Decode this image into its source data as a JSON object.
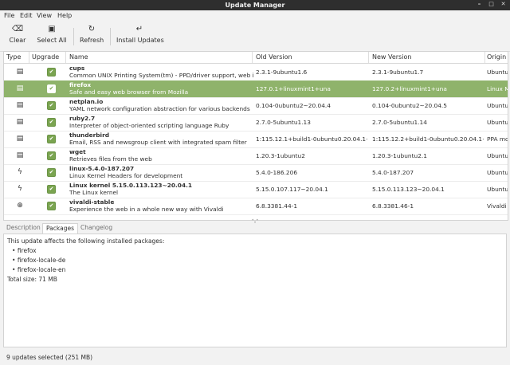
{
  "window": {
    "title": "Update Manager"
  },
  "menu": [
    "File",
    "Edit",
    "View",
    "Help"
  ],
  "toolbar": {
    "clear": "Clear",
    "select_all": "Select All",
    "refresh": "Refresh",
    "install": "Install Updates"
  },
  "columns": {
    "type": "Type",
    "upgrade": "Upgrade",
    "name": "Name",
    "old": "Old Version",
    "new": "New Version",
    "origin": "Origin"
  },
  "updates": [
    {
      "type_icon": "package-icon",
      "name": "cups",
      "desc": "Common UNIX Printing System(tm) - PPD/driver support, web interface",
      "old": "2.3.1-9ubuntu1.6",
      "new": "2.3.1-9ubuntu1.7",
      "origin": "Ubuntu",
      "checked": true,
      "selected": false
    },
    {
      "type_icon": "package-icon",
      "name": "firefox",
      "desc": "Safe and easy web browser from Mozilla",
      "old": "127.0.1+linuxmint1+una",
      "new": "127.0.2+linuxmint1+una",
      "origin": "Linux M",
      "checked": true,
      "selected": true
    },
    {
      "type_icon": "package-icon",
      "name": "netplan.io",
      "desc": "YAML network configuration abstraction for various backends",
      "old": "0.104-0ubuntu2~20.04.4",
      "new": "0.104-0ubuntu2~20.04.5",
      "origin": "Ubuntu",
      "checked": true,
      "selected": false
    },
    {
      "type_icon": "package-icon",
      "name": "ruby2.7",
      "desc": "Interpreter of object-oriented scripting language Ruby",
      "old": "2.7.0-5ubuntu1.13",
      "new": "2.7.0-5ubuntu1.14",
      "origin": "Ubuntu",
      "checked": true,
      "selected": false
    },
    {
      "type_icon": "package-icon",
      "name": "thunderbird",
      "desc": "Email, RSS and newsgroup client with integrated spam filter",
      "old": "1:115.12.1+build1-0ubuntu0.20.04.1~mt1",
      "new": "1:115.12.2+build1-0ubuntu0.20.04.1~mt1",
      "origin": "PPA moz",
      "checked": true,
      "selected": false
    },
    {
      "type_icon": "package-icon",
      "name": "wget",
      "desc": "Retrieves files from the web",
      "old": "1.20.3-1ubuntu2",
      "new": "1.20.3-1ubuntu2.1",
      "origin": "Ubuntu",
      "checked": true,
      "selected": false
    },
    {
      "type_icon": "kernel-icon",
      "name": "linux-5.4.0-187.207",
      "desc": "Linux Kernel Headers for development",
      "old": "5.4.0-186.206",
      "new": "5.4.0-187.207",
      "origin": "Ubuntu",
      "checked": true,
      "selected": false
    },
    {
      "type_icon": "kernel-icon",
      "name": "Linux kernel 5.15.0.113.123~20.04.1",
      "desc": "The Linux kernel",
      "old": "5.15.0.107.117~20.04.1",
      "new": "5.15.0.113.123~20.04.1",
      "origin": "Ubuntu",
      "checked": true,
      "selected": false
    },
    {
      "type_icon": "globe-icon",
      "name": "vivaldi-stable",
      "desc": "Experience the web in a whole new way with Vivaldi",
      "old": "6.8.3381.44-1",
      "new": "6.8.3381.46-1",
      "origin": "Vivaldi T",
      "checked": true,
      "selected": false
    }
  ],
  "tabs": [
    "Description",
    "Packages",
    "Changelog"
  ],
  "active_tab": "Packages",
  "packages_panel": {
    "intro": "This update affects the following installed packages:",
    "items": [
      "firefox",
      "firefox-locale-de",
      "firefox-locale-en"
    ],
    "total": "Total size: 71 MB"
  },
  "status": "9 updates selected (251 MB)",
  "colors": {
    "selection": "#8fb36b",
    "check": "#7aa450",
    "titlebar": "#2e2e2e"
  }
}
